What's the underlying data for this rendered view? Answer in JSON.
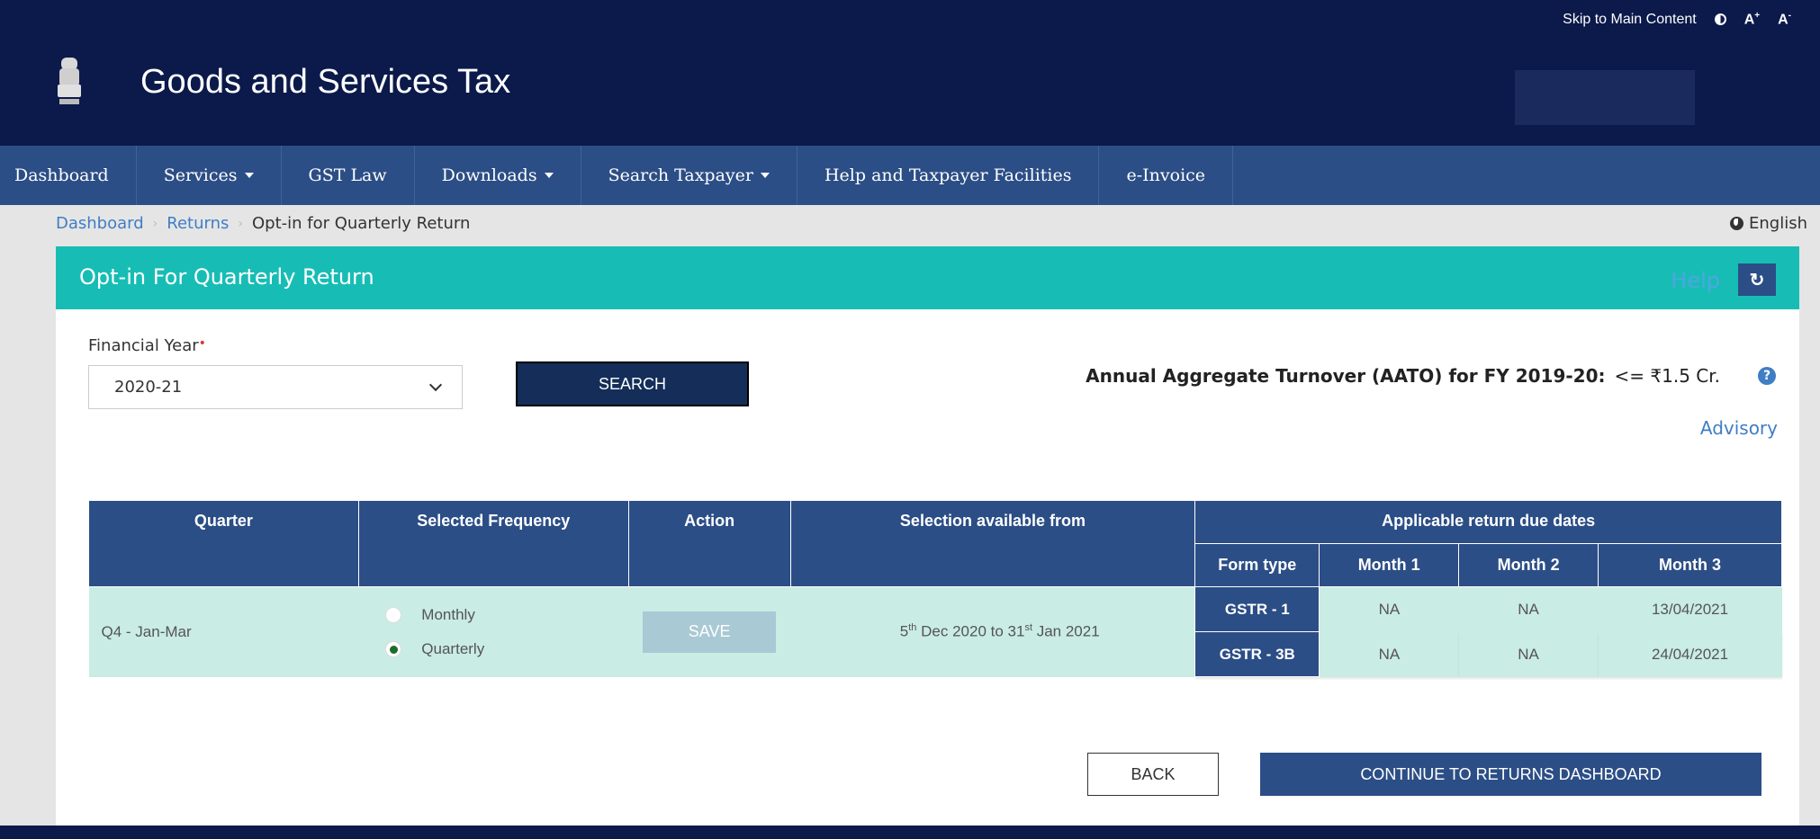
{
  "topbar": {
    "skip_link": "Skip to Main Content",
    "font_increase": "A",
    "font_increase_sup": "+",
    "font_decrease": "A",
    "font_decrease_sup": "-"
  },
  "header": {
    "title": "Goods and Services Tax"
  },
  "nav": {
    "items": [
      {
        "label": "Dashboard"
      },
      {
        "label": "Services"
      },
      {
        "label": "GST Law"
      },
      {
        "label": "Downloads"
      },
      {
        "label": "Search Taxpayer"
      },
      {
        "label": "Help and Taxpayer Facilities"
      },
      {
        "label": "e-Invoice"
      }
    ]
  },
  "breadcrumb": {
    "items": [
      "Dashboard",
      "Returns"
    ],
    "current": "Opt-in for Quarterly Return",
    "separator": "›"
  },
  "language": "English",
  "card": {
    "title": "Opt-in For Quarterly Return",
    "help": "Help",
    "refresh_glyph": "↻"
  },
  "form": {
    "fy_label": "Financial Year",
    "required_mark": "•",
    "fy_value": "2020-21",
    "search_label": "SEARCH",
    "aato_label": "Annual Aggregate Turnover (AATO) for FY 2019-20:",
    "aato_value": "<= ₹1.5 Cr.",
    "info_glyph": "?",
    "advisory": "Advisory"
  },
  "table": {
    "headers": {
      "quarter": "Quarter",
      "frequency": "Selected Frequency",
      "action": "Action",
      "selection": "Selection available from",
      "due_dates": "Applicable return due dates",
      "form_type": "Form type",
      "month1": "Month 1",
      "month2": "Month 2",
      "month3": "Month 3"
    },
    "row": {
      "quarter": "Q4 - Jan-Mar",
      "monthly": "Monthly",
      "quarterly": "Quarterly",
      "save": "SAVE",
      "sel_day1": "5",
      "sel_sup1": "th",
      "sel_mid": " Dec 2020 to 31",
      "sel_sup2": "st",
      "sel_end": " Jan 2021",
      "forms": [
        {
          "form": "GSTR - 1",
          "m1": "NA",
          "m2": "NA",
          "m3": "13/04/2021"
        },
        {
          "form": "GSTR - 3B",
          "m1": "NA",
          "m2": "NA",
          "m3": "24/04/2021"
        }
      ]
    }
  },
  "buttons": {
    "back": "BACK",
    "continue": "CONTINUE TO RETURNS DASHBOARD"
  },
  "colors": {
    "header_bg": "#0b1a4a",
    "nav_bg": "#2c4e86",
    "card_header_bg": "#17bdb5",
    "row_bg": "#c9ece4",
    "link": "#3f7ec4"
  }
}
